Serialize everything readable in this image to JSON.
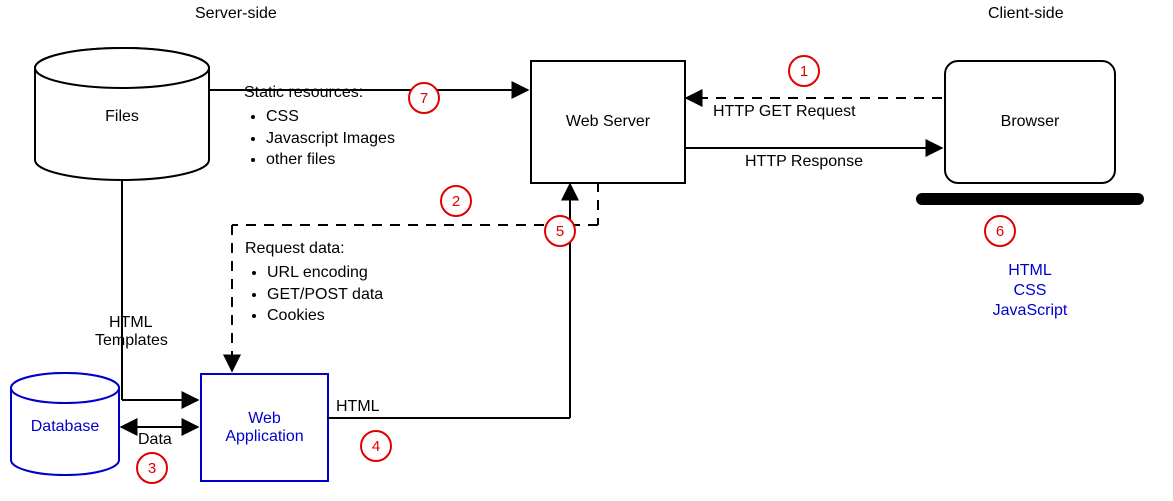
{
  "headers": {
    "server_side": "Server-side",
    "client_side": "Client-side"
  },
  "nodes": {
    "files": "Files",
    "web_server": "Web Server",
    "browser": "Browser",
    "database": "Database",
    "web_application_line1": "Web",
    "web_application_line2": "Application"
  },
  "edges": {
    "http_get": "HTTP GET Request",
    "http_response": "HTTP Response",
    "html_templates_line1": "HTML",
    "html_templates_line2": "Templates",
    "data": "Data",
    "html": "HTML"
  },
  "static_resources": {
    "title": "Static resources:",
    "items": [
      "CSS",
      "Javascript Images",
      "other files"
    ]
  },
  "request_data": {
    "title": "Request data:",
    "items": [
      "URL encoding",
      "GET/POST data",
      "Cookies"
    ]
  },
  "client_tech": {
    "line1": "HTML",
    "line2": "CSS",
    "line3": "JavaScript"
  },
  "steps": {
    "1": "1",
    "2": "2",
    "3": "3",
    "4": "4",
    "5": "5",
    "6": "6",
    "7": "7"
  }
}
